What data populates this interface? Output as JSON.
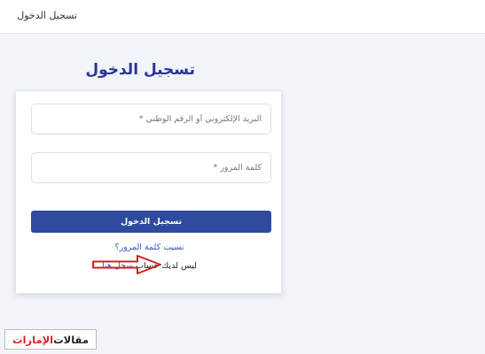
{
  "header": {
    "title": "تسجيل الدخول"
  },
  "page": {
    "heading": "تسجيل الدخول"
  },
  "form": {
    "email_placeholder": "البريد الإلكتروني أو الرقم الوطني *",
    "password_placeholder": "كلمة المرور *",
    "submit_label": "تسجيل الدخول",
    "forgot_label": "نسيت كلمة المرور؟",
    "register_prefix": "ليس لديك حساب ",
    "register_link": "سجل هنا"
  },
  "watermark": {
    "part_dark": "مقالات ",
    "part_red": "الإمارات"
  },
  "colors": {
    "accent": "#2e4b9e",
    "link": "#2e55b8",
    "heading": "#2c3394",
    "arrow": "#cc2020"
  },
  "icons": [
    "annotation-arrow-icon"
  ]
}
